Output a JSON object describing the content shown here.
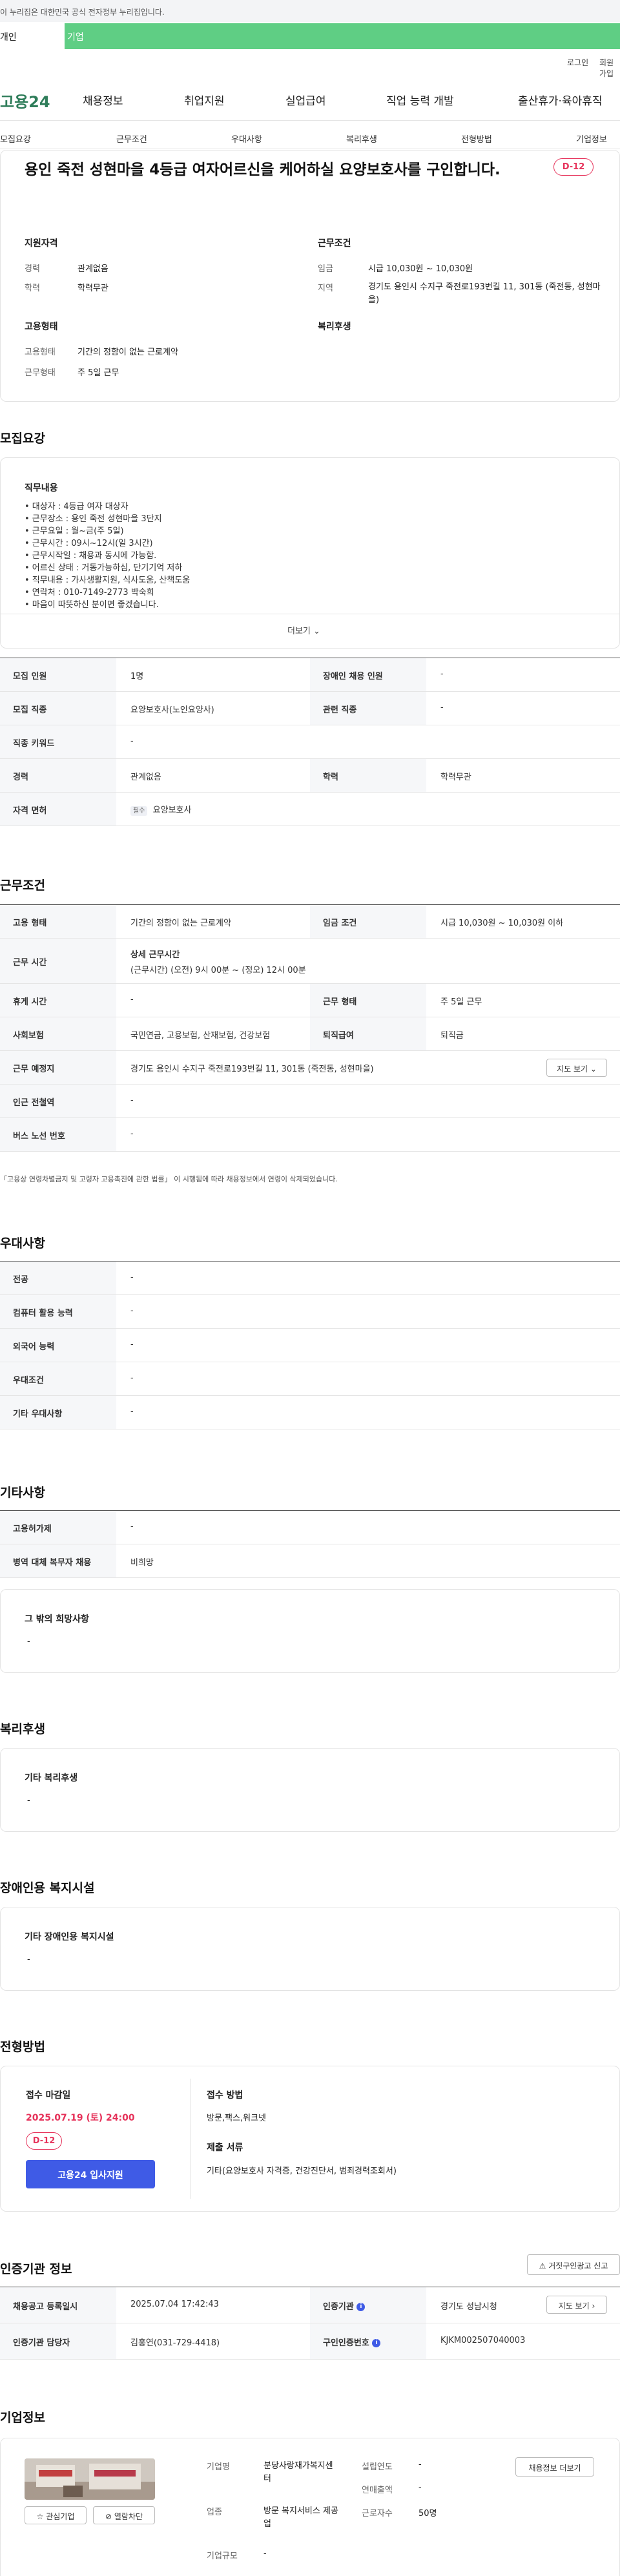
{
  "notice": "이 누리집은 대한민국 공식 전자정부 누리집입니다.",
  "tabs": {
    "active": "개인",
    "other": "기업"
  },
  "util": {
    "login": "로그인",
    "join": "회원가입"
  },
  "logo": {
    "text": "고용24"
  },
  "gnb": [
    "채용정보",
    "취업지원",
    "실업급여",
    "직업 능력 개발",
    "출산휴가·육아휴직"
  ],
  "subnav": [
    "모집요강",
    "근무조건",
    "우대사항",
    "복리후생",
    "전형방법",
    "기업정보"
  ],
  "summary": {
    "title": "용인 죽전 성현마을 4등급 여자어르신을 케어하실 요양보호사를 구인합니다.",
    "dday": "D-12",
    "qualify": {
      "heading": "지원자격",
      "career_label": "경력",
      "career": "관계없음",
      "edu_label": "학력",
      "edu": "학력무관"
    },
    "conditions": {
      "heading": "근무조건",
      "wage_label": "임금",
      "wage": "시급 10,030원 ~ 10,030원",
      "area_label": "지역",
      "area": "경기도 용인시 수지구 죽전로193번길 11, 301동 (죽전동, 성현마을)"
    },
    "employ": {
      "heading": "고용형태",
      "type_label": "고용형태",
      "type": "기간의 정함이 없는 근로계약",
      "days_label": "근무형태",
      "days": "주 5일 근무"
    },
    "welfare": {
      "heading": "복리후생"
    }
  },
  "recruit": {
    "heading": "모집요강",
    "duty_heading": "직무내용",
    "duty_lines": [
      "• 대상자 : 4등급 여자 대상자",
      "• 근무장소 : 용인 죽전 성현마을 3단지",
      "• 근무요일 : 월~금(주 5일)",
      "• 근무시간 : 09시~12시(일 3시간)",
      "• 근무시작일 : 채용과 동시에 가능함.",
      "• 어르신 상태 : 거동가능하심, 단기기억 저하",
      "• 직무내용 : 가사생활지원, 식사도움, 산책도움",
      "• 연락처 : 010-7149-2773 박숙희",
      "• 마음이 따뜻하신 분이면 좋겠습니다."
    ],
    "more": "더보기",
    "rows": {
      "headcount_label": "모집 인원",
      "headcount": "1명",
      "disabled_label": "장애인 채용 인원",
      "disabled": "-",
      "job_label": "모집 직종",
      "job": "요양보호사(노인요양사)",
      "related_label": "관련 직종",
      "related": "-",
      "keyword_label": "직종 키워드",
      "keyword": "-",
      "career_label": "경력",
      "career": "관계없음",
      "edu_label": "학력",
      "edu": "학력무관",
      "license_label": "자격 면허",
      "license_badge": "필수",
      "license": "요양보호사"
    }
  },
  "work": {
    "heading": "근무조건",
    "type_label": "고용 형태",
    "type": "기간의 정함이 없는 근로계약",
    "wage_label": "임금 조건",
    "wage": "시급 10,030원 ~ 10,030원 이하",
    "time_label": "근무 시간",
    "time_title": "상세 근무시간",
    "time": "(근무시간) (오전) 9시 00분 ~ (정오) 12시 00분",
    "break_label": "휴게 시간",
    "break": "-",
    "form_label": "근무 형태",
    "form": "주 5일 근무",
    "ins_label": "사회보험",
    "ins": "국민연금, 고용보험, 산재보험, 건강보험",
    "sev_label": "퇴직급여",
    "sev": "퇴직금",
    "place_label": "근무 예정지",
    "place": "경기도 용인시 수지구 죽전로193번길 11, 301동 (죽전동, 성현마을)",
    "map_btn": "지도 보기",
    "subway_label": "인근 전철역",
    "subway": "-",
    "bus_label": "버스 노선 번호",
    "bus": "-",
    "note": "「고용상 연령차별금지 및 고령자 고용촉진에 관한 법률」 이 시행됨에 따라 채용정보에서 연령이 삭제되었습니다."
  },
  "pref": {
    "heading": "우대사항",
    "rows": [
      {
        "label": "전공",
        "value": "-"
      },
      {
        "label": "컴퓨터 활용 능력",
        "value": "-"
      },
      {
        "label": "외국어 능력",
        "value": "-"
      },
      {
        "label": "우대조건",
        "value": "-"
      },
      {
        "label": "기타 우대사항",
        "value": "-"
      }
    ]
  },
  "etc": {
    "heading": "기타사항",
    "rows": [
      {
        "label": "고용허가제",
        "value": "-"
      },
      {
        "label": "병역 대체 복무자 채용",
        "value": "비희망"
      }
    ],
    "other_title": "그 밖의 희망사항",
    "other": "-"
  },
  "welfare": {
    "heading": "복리후생",
    "title": "기타 복리후생",
    "value": "-"
  },
  "facility": {
    "heading": "장애인용 복지시설",
    "title": "기타 장애인용 복지시설",
    "value": "-"
  },
  "selection": {
    "heading": "전형방법",
    "deadline_label": "접수 마감일",
    "deadline": "2025.07.19 (토) 24:00",
    "dday": "D-12",
    "apply_btn": "고용24 입사지원",
    "method_label": "접수 방법",
    "method": "방문,팩스,워크넷",
    "docs_label": "제출 서류",
    "docs": "기타(요양보호사 자격증, 건강진단서, 범죄경력조회서)"
  },
  "agency": {
    "heading": "인증기관 정보",
    "report_btn": "거짓구인광고 신고",
    "reg_label": "채용공고 등록일시",
    "reg": "2025.07.04 17:42:43",
    "org_label": "인증기관",
    "org": "경기도 성남시청",
    "map_btn": "지도 보기",
    "mgr_label": "인증기관 담당자",
    "mgr": "김홍연(031-729-4418)",
    "no_label": "구인인증번호",
    "no": "KJKM002507040003"
  },
  "company": {
    "heading": "기업정보",
    "info_btn": "채용정보 더보기",
    "fav_btn": "관심기업",
    "block_btn": "열람차단",
    "name_label": "기업명",
    "name": "분당사랑재가복지센터",
    "biz_label": "업종",
    "biz": "방문 복지서비스 제공업",
    "size_label": "기업규모",
    "size": "-",
    "est_label": "설립연도",
    "est": "-",
    "sales_label": "연매출액",
    "sales": "-",
    "emp_label": "근로자수",
    "emp": "50명"
  }
}
